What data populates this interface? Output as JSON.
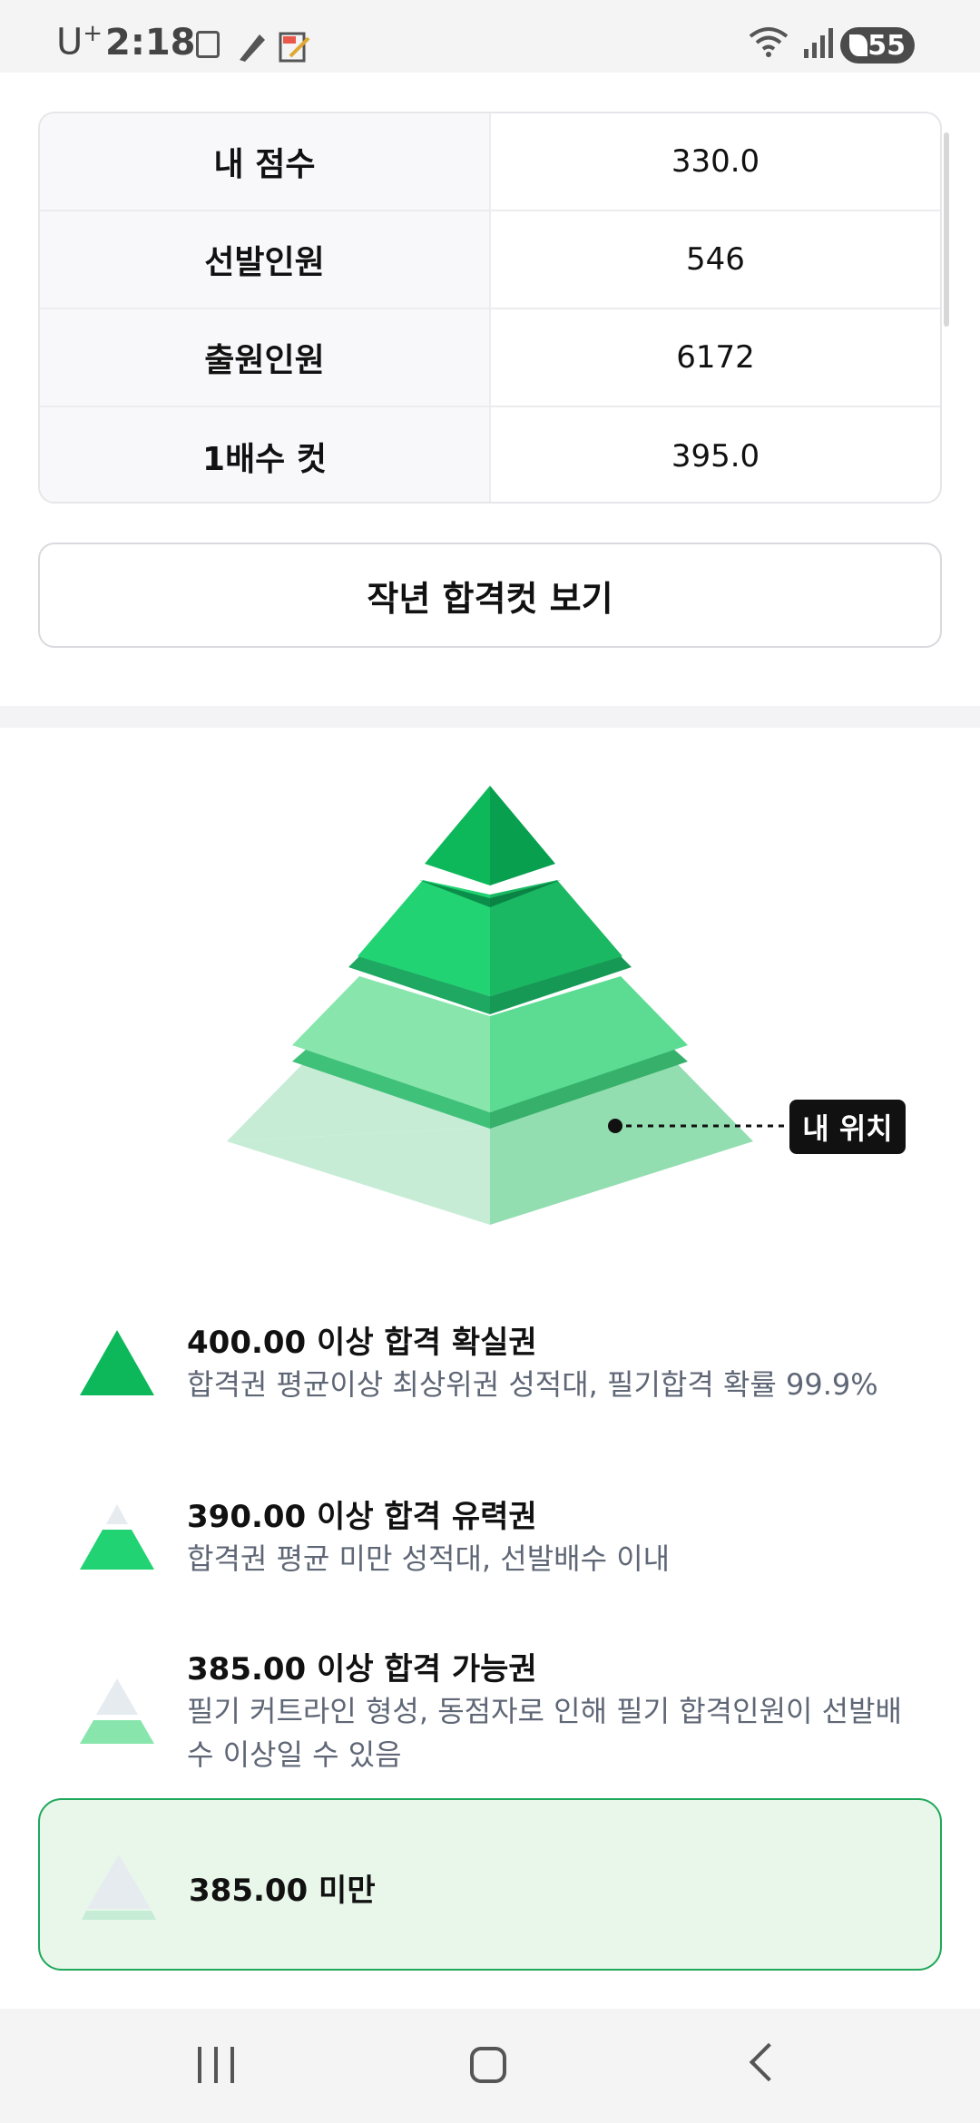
{
  "status_bar": {
    "carrier": "U",
    "carrier_sup": "+",
    "time": "2:18",
    "battery": "55",
    "icons": [
      "sim-icon",
      "pen-icon",
      "memo-icon",
      "wifi-icon",
      "signal-icon",
      "battery-icon"
    ]
  },
  "score_table": [
    {
      "label": "내 점수",
      "value": "330.0"
    },
    {
      "label": "선발인원",
      "value": "546"
    },
    {
      "label": "출원인원",
      "value": "6172"
    },
    {
      "label": "1배수 컷",
      "value": "395.0"
    }
  ],
  "last_year_button": "작년 합격컷 보기",
  "pyramid": {
    "my_position_label": "내 위치",
    "colors": {
      "tier1": "#0db85b",
      "tier2": "#22d373",
      "tier3": "#7fe3a7",
      "tier4": "#c6ecd6",
      "highlight_border": "#1fa85a",
      "highlight_bg": "#e8f7ea"
    }
  },
  "legend": [
    {
      "title": "400.00 이상 합격 확실권",
      "desc": "합격권 평균이상 최상위권 성적대, 필기합격 확률 99.9%"
    },
    {
      "title": "390.00 이상 합격 유력권",
      "desc": "합격권 평균 미만 성적대, 선발배수 이내"
    },
    {
      "title": "385.00 이상 합격 가능권",
      "desc": "필기 커트라인 형성, 동점자로 인해 필기 합격인원이 선발배수 이상일 수 있음"
    },
    {
      "title": "385.00 미만",
      "desc": "",
      "selected": true
    }
  ],
  "nav_bar": {
    "icons": [
      "recent-apps-icon",
      "home-icon",
      "back-icon"
    ]
  }
}
